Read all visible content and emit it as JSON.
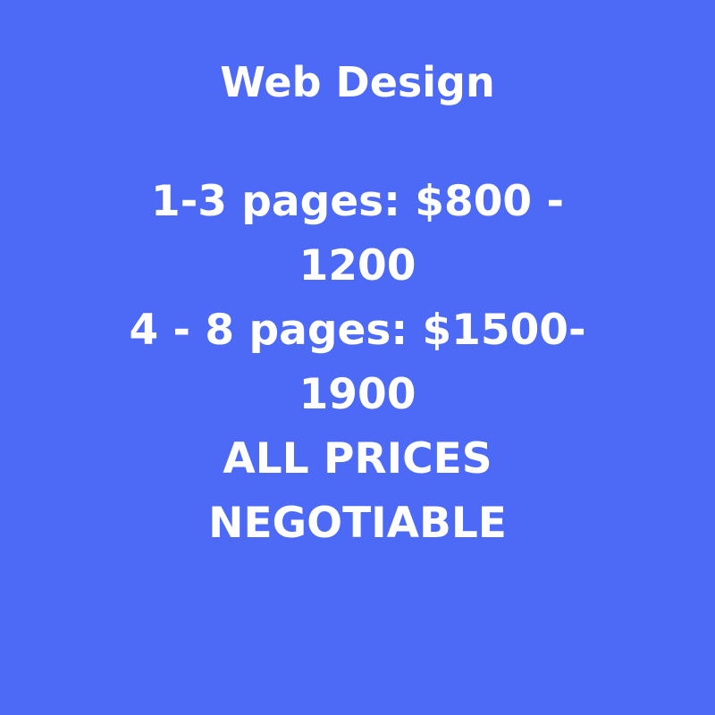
{
  "background_color": "#4c6af5",
  "text_color": "#ffffff",
  "title": "Web Design",
  "lines": [
    "1-3 pages: $800 -",
    "1200",
    "4 - 8 pages: $1500-",
    "1900",
    "ALL PRICES",
    "NEGOTIABLE"
  ]
}
